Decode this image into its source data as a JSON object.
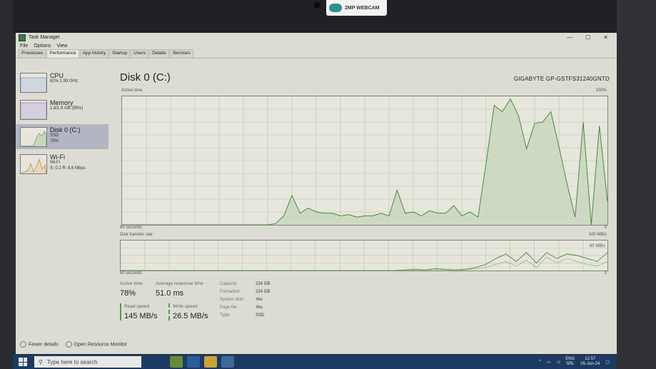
{
  "webcam_label": "2MP WEBCAM",
  "window": {
    "title": "Task Manager",
    "menu": [
      "File",
      "Options",
      "View"
    ],
    "tabs": [
      "Processes",
      "Performance",
      "App history",
      "Startup",
      "Users",
      "Details",
      "Services"
    ],
    "active_tab": "Performance"
  },
  "sidebar": {
    "items": [
      {
        "title": "CPU",
        "line1": "62%  1.99 GHz",
        "line2": ""
      },
      {
        "title": "Memory",
        "line1": "1.8/1.9 GB (95%)",
        "line2": ""
      },
      {
        "title": "Disk 0 (C:)",
        "line1": "SSD",
        "line2": "78%"
      },
      {
        "title": "Wi-Fi",
        "line1": "Wi-Fi",
        "line2": "S: 0.2  R: 8.6 Mbps"
      }
    ]
  },
  "main": {
    "title": "Disk 0 (C:)",
    "model": "GIGABYTE GP-GSTFS31240GNTD",
    "active_time_label": "Active time",
    "active_max": "100%",
    "seconds_label": "60 seconds",
    "zero_label": "0",
    "transfer_label": "Disk transfer rate",
    "transfer_max": "100 MB/s",
    "transfer_mid": "60 MB/s",
    "transfer_seconds": "60 seconds",
    "transfer_zero": "0"
  },
  "stats": {
    "active_time_label": "Active time",
    "active_time": "78%",
    "avg_resp_label": "Average response time",
    "avg_resp": "51.0 ms",
    "read_label": "Read speed",
    "read": "145 MB/s",
    "write_label": "Write speed",
    "write": "26.5 MB/s",
    "props": [
      {
        "k": "Capacity:",
        "v": "224 GB"
      },
      {
        "k": "Formatted:",
        "v": "224 GB"
      },
      {
        "k": "System disk:",
        "v": "Yes"
      },
      {
        "k": "Page file:",
        "v": "Yes"
      },
      {
        "k": "Type:",
        "v": "SSD"
      }
    ]
  },
  "footer": {
    "fewer": "Fewer details",
    "resmon": "Open Resource Monitor"
  },
  "taskbar": {
    "search_placeholder": "Type here to search",
    "lang1": "ENG",
    "lang2": "SRL",
    "time": "12:57",
    "date": "05-Jun-24"
  },
  "chart_data": [
    {
      "type": "area",
      "title": "Active time",
      "ylim": [
        0,
        100
      ],
      "x": [
        0,
        2,
        4,
        6,
        8,
        10,
        12,
        14,
        16,
        18,
        20,
        22,
        24,
        26,
        28,
        30,
        32,
        34,
        36,
        38,
        40,
        42,
        44,
        46,
        48,
        50,
        52,
        54,
        56,
        58,
        60
      ],
      "values": [
        0,
        0,
        0,
        0,
        0,
        0,
        0,
        0,
        0,
        0,
        0,
        0,
        0,
        0,
        0,
        0,
        0,
        0,
        0,
        1,
        7,
        23,
        9,
        13,
        10,
        9,
        9,
        7,
        8,
        6,
        7,
        7,
        9,
        7,
        27,
        9,
        10,
        7,
        11,
        9,
        9,
        15,
        7,
        10,
        6,
        48,
        93,
        88,
        98,
        85,
        59,
        79,
        80,
        88,
        61,
        32,
        6,
        80,
        0,
        77,
        18
      ],
      "grid": true
    },
    {
      "type": "line",
      "title": "Disk transfer rate",
      "ylim": [
        0,
        100
      ],
      "series": [
        {
          "name": "Read speed",
          "values": [
            0,
            0,
            0,
            0,
            0,
            0,
            0,
            0,
            0,
            0,
            0,
            0,
            0,
            0,
            0,
            0,
            0,
            0,
            0,
            0,
            0,
            0,
            0,
            0,
            0,
            0,
            0,
            0,
            2,
            4,
            2,
            6,
            4,
            2,
            4,
            10,
            20,
            40,
            55,
            30,
            60,
            25,
            60,
            40,
            55,
            50,
            40,
            30,
            60
          ]
        },
        {
          "name": "Write speed",
          "values": [
            0,
            0,
            0,
            0,
            0,
            0,
            0,
            0,
            0,
            0,
            0,
            0,
            0,
            0,
            0,
            0,
            0,
            0,
            0,
            0,
            0,
            0,
            0,
            0,
            0,
            0,
            0,
            0,
            1,
            2,
            1,
            3,
            2,
            1,
            2,
            5,
            10,
            20,
            30,
            15,
            35,
            10,
            45,
            25,
            40,
            30,
            20,
            15,
            30
          ]
        }
      ],
      "grid": true
    }
  ]
}
